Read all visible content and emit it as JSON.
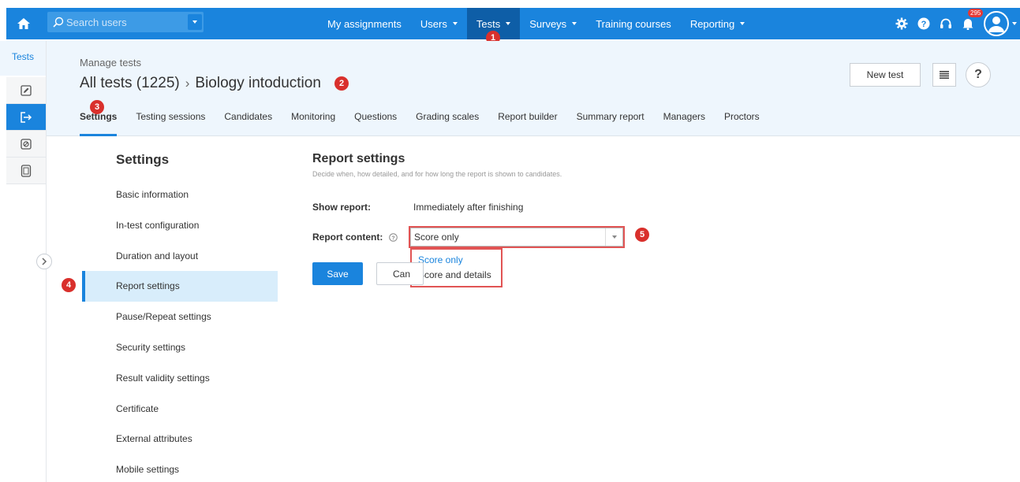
{
  "topbar": {
    "search_placeholder": "Search users",
    "nav": [
      {
        "label": "My assignments",
        "dropdown": false,
        "active": false
      },
      {
        "label": "Users",
        "dropdown": true,
        "active": false
      },
      {
        "label": "Tests",
        "dropdown": true,
        "active": true
      },
      {
        "label": "Surveys",
        "dropdown": true,
        "active": false
      },
      {
        "label": "Training courses",
        "dropdown": false,
        "active": false
      },
      {
        "label": "Reporting",
        "dropdown": true,
        "active": false
      }
    ],
    "notification_count": "295",
    "icons": [
      "home-icon",
      "search-icon",
      "gear-icon",
      "help-icon",
      "headset-icon",
      "bell-icon",
      "user-avatar-icon"
    ]
  },
  "rail": {
    "label": "Tests",
    "icons": [
      "edit-icon",
      "exit-icon",
      "stamp-icon",
      "document-icon"
    ],
    "active_index": 1
  },
  "header": {
    "section": "Manage tests",
    "breadcrumb_root": "All tests (1225)",
    "breadcrumb_sep": "›",
    "breadcrumb_current": "Biology intoduction",
    "new_test_label": "New test",
    "help_label": "?"
  },
  "tabs": [
    "Settings",
    "Testing sessions",
    "Candidates",
    "Monitoring",
    "Questions",
    "Grading scales",
    "Report builder",
    "Summary report",
    "Managers",
    "Proctors"
  ],
  "markers": [
    "1",
    "2",
    "3",
    "4",
    "5"
  ],
  "settings_sidebar": {
    "title": "Settings",
    "items": [
      "Basic information",
      "In-test configuration",
      "Duration and layout",
      "Report settings",
      "Pause/Repeat settings",
      "Security settings",
      "Result validity settings",
      "Certificate",
      "External attributes",
      "Mobile settings"
    ],
    "active_index": 3
  },
  "report_settings": {
    "title": "Report settings",
    "subtitle": "Decide when, how detailed, and for how long the report is shown to candidates.",
    "show_report_label": "Show report:",
    "show_report_value": "Immediately after finishing",
    "content_label": "Report content:",
    "content_value": "Score only",
    "options": [
      "Score only",
      "Score and details"
    ],
    "save_label": "Save",
    "cancel_label": "Can"
  },
  "colors": {
    "primary": "#1a84dd",
    "nav_active": "#0e5ea7",
    "marker": "#d9302c",
    "highlight": "#e15454"
  }
}
